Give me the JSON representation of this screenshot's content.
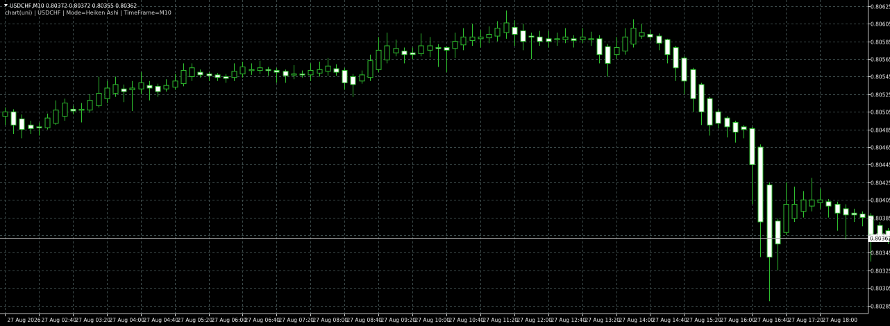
{
  "header": {
    "symbol_line": "USDCHF,M10  0.80372 0.80372 0.80355 0.80362",
    "indicator_line": "chart(uni) | USDCHF | Mode=Heiken Ashi | TimeFrame=M10"
  },
  "colors": {
    "background": "#000000",
    "grid": "#3c4a4a",
    "axis": "#c8c8c8",
    "wick": "#2fbf2f",
    "bull_body": "#000000",
    "bull_border": "#2fbf2f",
    "bear_body": "#ffffff",
    "bear_border": "#2fbf2f",
    "price_line": "#a8a8a8",
    "text": "#e8e8e8"
  },
  "chart_data": {
    "type": "candlestick",
    "mode": "Heiken Ashi",
    "timeframe": "M10",
    "ylim": [
      0.80276,
      0.80632
    ],
    "grid": true,
    "current_price": "0.80362",
    "y_ticks": [
      "0.80625",
      "0.80605",
      "0.80585",
      "0.80565",
      "0.80545",
      "0.80525",
      "0.80505",
      "0.80485",
      "0.80465",
      "0.80445",
      "0.80425",
      "0.80405",
      "0.80385",
      "0.80365",
      "0.80345",
      "0.80325",
      "0.80305",
      "0.80285"
    ],
    "x_ticks": [
      {
        "index": 0,
        "label": "27 Aug 2026"
      },
      {
        "index": 4,
        "label": "27 Aug 02:40"
      },
      {
        "index": 8,
        "label": "27 Aug 03:20"
      },
      {
        "index": 12,
        "label": "27 Aug 04:00"
      },
      {
        "index": 16,
        "label": "27 Aug 04:40"
      },
      {
        "index": 20,
        "label": "27 Aug 05:20"
      },
      {
        "index": 24,
        "label": "27 Aug 06:00"
      },
      {
        "index": 28,
        "label": "27 Aug 06:40"
      },
      {
        "index": 32,
        "label": "27 Aug 07:20"
      },
      {
        "index": 36,
        "label": "27 Aug 08:00"
      },
      {
        "index": 40,
        "label": "27 Aug 08:40"
      },
      {
        "index": 44,
        "label": "27 Aug 09:20"
      },
      {
        "index": 48,
        "label": "27 Aug 10:00"
      },
      {
        "index": 52,
        "label": "27 Aug 10:40"
      },
      {
        "index": 56,
        "label": "27 Aug 11:20"
      },
      {
        "index": 60,
        "label": "27 Aug 12:00"
      },
      {
        "index": 64,
        "label": "27 Aug 12:40"
      },
      {
        "index": 68,
        "label": "27 Aug 13:20"
      },
      {
        "index": 72,
        "label": "27 Aug 14:00"
      },
      {
        "index": 76,
        "label": "27 Aug 14:40"
      },
      {
        "index": 80,
        "label": "27 Aug 15:20"
      },
      {
        "index": 84,
        "label": "27 Aug 16:00"
      },
      {
        "index": 88,
        "label": "27 Aug 16:40"
      },
      {
        "index": 92,
        "label": "27 Aug 17:20"
      },
      {
        "index": 96,
        "label": "27 Aug 18:00"
      }
    ],
    "candles": [
      {
        "o": 0.805,
        "c": 0.80505,
        "h": 0.8051,
        "l": 0.8049
      },
      {
        "o": 0.80505,
        "c": 0.8049,
        "h": 0.80508,
        "l": 0.8048
      },
      {
        "o": 0.80497,
        "c": 0.80485,
        "h": 0.80502,
        "l": 0.80475
      },
      {
        "o": 0.8049,
        "c": 0.80486,
        "h": 0.80495,
        "l": 0.8048
      },
      {
        "o": 0.80488,
        "c": 0.80487,
        "h": 0.80493,
        "l": 0.80478
      },
      {
        "o": 0.80487,
        "c": 0.80498,
        "h": 0.80503,
        "l": 0.80485
      },
      {
        "o": 0.80492,
        "c": 0.80507,
        "h": 0.80518,
        "l": 0.8049
      },
      {
        "o": 0.805,
        "c": 0.80515,
        "h": 0.8052,
        "l": 0.80495
      },
      {
        "o": 0.80508,
        "c": 0.80506,
        "h": 0.80512,
        "l": 0.80502
      },
      {
        "o": 0.80507,
        "c": 0.80508,
        "h": 0.80515,
        "l": 0.80493
      },
      {
        "o": 0.80507,
        "c": 0.80518,
        "h": 0.80525,
        "l": 0.80504
      },
      {
        "o": 0.80512,
        "c": 0.80526,
        "h": 0.80545,
        "l": 0.8051
      },
      {
        "o": 0.8052,
        "c": 0.80532,
        "h": 0.8054,
        "l": 0.80515
      },
      {
        "o": 0.80526,
        "c": 0.80536,
        "h": 0.80545,
        "l": 0.80522
      },
      {
        "o": 0.80531,
        "c": 0.80528,
        "h": 0.80536,
        "l": 0.80516
      },
      {
        "o": 0.8053,
        "c": 0.80532,
        "h": 0.8054,
        "l": 0.80506
      },
      {
        "o": 0.80531,
        "c": 0.80538,
        "h": 0.8055,
        "l": 0.80525
      },
      {
        "o": 0.80535,
        "c": 0.80532,
        "h": 0.8054,
        "l": 0.80518
      },
      {
        "o": 0.80534,
        "c": 0.80528,
        "h": 0.80537,
        "l": 0.80522
      },
      {
        "o": 0.80531,
        "c": 0.80535,
        "h": 0.80542,
        "l": 0.80528
      },
      {
        "o": 0.80533,
        "c": 0.8054,
        "h": 0.80548,
        "l": 0.8053
      },
      {
        "o": 0.80537,
        "c": 0.80552,
        "h": 0.8056,
        "l": 0.80534
      },
      {
        "o": 0.80545,
        "c": 0.80555,
        "h": 0.8056,
        "l": 0.8054
      },
      {
        "o": 0.8055,
        "c": 0.80547,
        "h": 0.80553,
        "l": 0.80544
      },
      {
        "o": 0.80548,
        "c": 0.80546,
        "h": 0.8055,
        "l": 0.8054
      },
      {
        "o": 0.80547,
        "c": 0.80544,
        "h": 0.80549,
        "l": 0.8054
      },
      {
        "o": 0.80545,
        "c": 0.80543,
        "h": 0.80548,
        "l": 0.80538
      },
      {
        "o": 0.80544,
        "c": 0.80551,
        "h": 0.8056,
        "l": 0.8054
      },
      {
        "o": 0.80548,
        "c": 0.80556,
        "h": 0.80562,
        "l": 0.80544
      },
      {
        "o": 0.80552,
        "c": 0.80553,
        "h": 0.8056,
        "l": 0.80547
      },
      {
        "o": 0.80552,
        "c": 0.80555,
        "h": 0.80563,
        "l": 0.80548
      },
      {
        "o": 0.80553,
        "c": 0.80552,
        "h": 0.80556,
        "l": 0.80546
      },
      {
        "o": 0.80552,
        "c": 0.8055,
        "h": 0.80555,
        "l": 0.80538
      },
      {
        "o": 0.80551,
        "c": 0.80546,
        "h": 0.80553,
        "l": 0.80538
      },
      {
        "o": 0.80548,
        "c": 0.80548,
        "h": 0.80558,
        "l": 0.80542
      },
      {
        "o": 0.80548,
        "c": 0.80547,
        "h": 0.80552,
        "l": 0.80544
      },
      {
        "o": 0.80547,
        "c": 0.80552,
        "h": 0.8056,
        "l": 0.8054
      },
      {
        "o": 0.80549,
        "c": 0.80553,
        "h": 0.80562,
        "l": 0.80545
      },
      {
        "o": 0.80551,
        "c": 0.80557,
        "h": 0.80566,
        "l": 0.80546
      },
      {
        "o": 0.80554,
        "c": 0.8055,
        "h": 0.80559,
        "l": 0.80546
      },
      {
        "o": 0.80552,
        "c": 0.80538,
        "h": 0.80555,
        "l": 0.8053
      },
      {
        "o": 0.80545,
        "c": 0.80536,
        "h": 0.80548,
        "l": 0.80522
      },
      {
        "o": 0.8054,
        "c": 0.80547,
        "h": 0.80552,
        "l": 0.80537
      },
      {
        "o": 0.80544,
        "c": 0.80563,
        "h": 0.8057,
        "l": 0.8054
      },
      {
        "o": 0.80553,
        "c": 0.80575,
        "h": 0.8059,
        "l": 0.8055
      },
      {
        "o": 0.80564,
        "c": 0.8058,
        "h": 0.80595,
        "l": 0.8056
      },
      {
        "o": 0.80572,
        "c": 0.80577,
        "h": 0.80587,
        "l": 0.80568
      },
      {
        "o": 0.80574,
        "c": 0.8057,
        "h": 0.80578,
        "l": 0.8056
      },
      {
        "o": 0.80572,
        "c": 0.8057,
        "h": 0.80578,
        "l": 0.80565
      },
      {
        "o": 0.80571,
        "c": 0.8058,
        "h": 0.80594,
        "l": 0.80568
      },
      {
        "o": 0.80575,
        "c": 0.8058,
        "h": 0.8059,
        "l": 0.80567
      },
      {
        "o": 0.80578,
        "c": 0.80577,
        "h": 0.80582,
        "l": 0.80556
      },
      {
        "o": 0.80578,
        "c": 0.80575,
        "h": 0.80579,
        "l": 0.8055
      },
      {
        "o": 0.80577,
        "c": 0.80585,
        "h": 0.80595,
        "l": 0.80566
      },
      {
        "o": 0.80581,
        "c": 0.8059,
        "h": 0.806,
        "l": 0.80575
      },
      {
        "o": 0.80586,
        "c": 0.8059,
        "h": 0.80605,
        "l": 0.8058
      },
      {
        "o": 0.80588,
        "c": 0.8059,
        "h": 0.80598,
        "l": 0.80578
      },
      {
        "o": 0.80589,
        "c": 0.80593,
        "h": 0.80602,
        "l": 0.80583
      },
      {
        "o": 0.80591,
        "c": 0.806,
        "h": 0.80608,
        "l": 0.80585
      },
      {
        "o": 0.80595,
        "c": 0.80606,
        "h": 0.8062,
        "l": 0.80588
      },
      {
        "o": 0.80601,
        "c": 0.80593,
        "h": 0.80609,
        "l": 0.8058
      },
      {
        "o": 0.80597,
        "c": 0.80585,
        "h": 0.80605,
        "l": 0.80575
      },
      {
        "o": 0.80591,
        "c": 0.8059,
        "h": 0.80595,
        "l": 0.80565
      },
      {
        "o": 0.8059,
        "c": 0.80585,
        "h": 0.80597,
        "l": 0.8058
      },
      {
        "o": 0.80588,
        "c": 0.80585,
        "h": 0.80597,
        "l": 0.80578
      },
      {
        "o": 0.80587,
        "c": 0.80588,
        "h": 0.80595,
        "l": 0.8058
      },
      {
        "o": 0.80587,
        "c": 0.8059,
        "h": 0.806,
        "l": 0.80583
      },
      {
        "o": 0.80588,
        "c": 0.80586,
        "h": 0.80592,
        "l": 0.80578
      },
      {
        "o": 0.80587,
        "c": 0.8059,
        "h": 0.806,
        "l": 0.80583
      },
      {
        "o": 0.80588,
        "c": 0.80588,
        "h": 0.80596,
        "l": 0.8058
      },
      {
        "o": 0.80588,
        "c": 0.8057,
        "h": 0.80592,
        "l": 0.8056
      },
      {
        "o": 0.80579,
        "c": 0.8056,
        "h": 0.80582,
        "l": 0.80545
      },
      {
        "o": 0.8057,
        "c": 0.80578,
        "h": 0.8059,
        "l": 0.80565
      },
      {
        "o": 0.80574,
        "c": 0.8059,
        "h": 0.806,
        "l": 0.8057
      },
      {
        "o": 0.80582,
        "c": 0.806,
        "h": 0.8061,
        "l": 0.80578
      },
      {
        "o": 0.80591,
        "c": 0.80595,
        "h": 0.80605,
        "l": 0.80588
      },
      {
        "o": 0.80593,
        "c": 0.8059,
        "h": 0.80598,
        "l": 0.80586
      },
      {
        "o": 0.80591,
        "c": 0.80583,
        "h": 0.80594,
        "l": 0.80575
      },
      {
        "o": 0.80587,
        "c": 0.8057,
        "h": 0.80588,
        "l": 0.8056
      },
      {
        "o": 0.80578,
        "c": 0.80555,
        "h": 0.8058,
        "l": 0.8054
      },
      {
        "o": 0.80566,
        "c": 0.8054,
        "h": 0.80568,
        "l": 0.80525
      },
      {
        "o": 0.80553,
        "c": 0.8052,
        "h": 0.80555,
        "l": 0.80505
      },
      {
        "o": 0.80536,
        "c": 0.80505,
        "h": 0.80538,
        "l": 0.8049
      },
      {
        "o": 0.8052,
        "c": 0.8049,
        "h": 0.80522,
        "l": 0.80478
      },
      {
        "o": 0.80505,
        "c": 0.80492,
        "h": 0.80508,
        "l": 0.80486
      },
      {
        "o": 0.80498,
        "c": 0.80488,
        "h": 0.805,
        "l": 0.80476
      },
      {
        "o": 0.80493,
        "c": 0.80482,
        "h": 0.80495,
        "l": 0.8047
      },
      {
        "o": 0.80488,
        "c": 0.80485,
        "h": 0.8049,
        "l": 0.80475
      },
      {
        "o": 0.80486,
        "c": 0.80445,
        "h": 0.80488,
        "l": 0.804
      },
      {
        "o": 0.80465,
        "c": 0.8038,
        "h": 0.80468,
        "l": 0.8034
      },
      {
        "o": 0.80422,
        "c": 0.8034,
        "h": 0.80425,
        "l": 0.8029
      },
      {
        "o": 0.80381,
        "c": 0.80355,
        "h": 0.80384,
        "l": 0.80325
      },
      {
        "o": 0.80368,
        "c": 0.804,
        "h": 0.80425,
        "l": 0.80365
      },
      {
        "o": 0.80384,
        "c": 0.804,
        "h": 0.8042,
        "l": 0.8038
      },
      {
        "o": 0.80392,
        "c": 0.80405,
        "h": 0.80415,
        "l": 0.80385
      },
      {
        "o": 0.80398,
        "c": 0.80405,
        "h": 0.8043,
        "l": 0.80392
      },
      {
        "o": 0.80402,
        "c": 0.80405,
        "h": 0.80418,
        "l": 0.80395
      },
      {
        "o": 0.80403,
        "c": 0.80398,
        "h": 0.80406,
        "l": 0.80385
      },
      {
        "o": 0.804,
        "c": 0.8039,
        "h": 0.80403,
        "l": 0.8037
      },
      {
        "o": 0.80395,
        "c": 0.80388,
        "h": 0.804,
        "l": 0.8036
      },
      {
        "o": 0.8039,
        "c": 0.80388,
        "h": 0.80395,
        "l": 0.8038
      },
      {
        "o": 0.80389,
        "c": 0.80385,
        "h": 0.80392,
        "l": 0.80375
      },
      {
        "o": 0.80387,
        "c": 0.80366,
        "h": 0.8039,
        "l": 0.80335
      },
      {
        "o": 0.80376,
        "c": 0.80363,
        "h": 0.8038,
        "l": 0.80358
      },
      {
        "o": 0.8037,
        "c": 0.80362,
        "h": 0.80373,
        "l": 0.80355
      }
    ]
  }
}
